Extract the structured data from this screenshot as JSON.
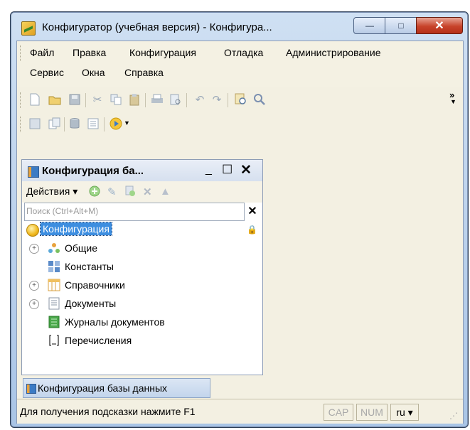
{
  "window": {
    "title": "Конфигуратор (учебная версия) - Конфигура...",
    "minimize": "—",
    "maximize": "□",
    "close": "✕"
  },
  "menu": {
    "row1": [
      "Файл",
      "Правка",
      "Конфигурация",
      "Отладка",
      "Администрирование"
    ],
    "row2": [
      "Сервис",
      "Окна",
      "Справка"
    ],
    "overflow": "»"
  },
  "panel": {
    "title": "Конфигурация ба...",
    "actions_label": "Действия ▾",
    "search_placeholder": "Поиск (Ctrl+Alt+M)",
    "tree": {
      "root": "Конфигурация",
      "items": [
        {
          "label": "Общие",
          "expandable": true,
          "icon": "common-icon"
        },
        {
          "label": "Константы",
          "expandable": false,
          "icon": "constants-icon"
        },
        {
          "label": "Справочники",
          "expandable": true,
          "icon": "catalogs-icon"
        },
        {
          "label": "Документы",
          "expandable": true,
          "icon": "documents-icon"
        },
        {
          "label": "Журналы документов",
          "expandable": false,
          "icon": "journals-icon"
        },
        {
          "label": "Перечисления",
          "expandable": false,
          "icon": "enums-icon"
        }
      ]
    },
    "tab_label": "Конфигурация базы данных"
  },
  "status": {
    "hint": "Для получения подсказки нажмите F1",
    "cap": "CAP",
    "num": "NUM",
    "lang": "ru ▾"
  },
  "colors": {
    "selection": "#3d8ee0",
    "client_bg": "#f3f0e2",
    "close_button": "#c7432a"
  }
}
